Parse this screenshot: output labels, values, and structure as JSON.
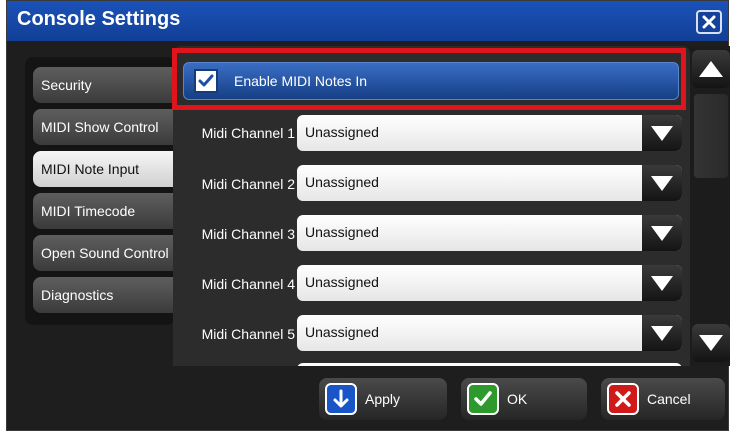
{
  "window": {
    "title": "Console Settings"
  },
  "tabs": [
    {
      "label": "Security",
      "active": false
    },
    {
      "label": "MIDI Show Control",
      "active": false
    },
    {
      "label": "MIDI Note Input",
      "active": true
    },
    {
      "label": "MIDI Timecode",
      "active": false
    },
    {
      "label": "Open Sound Control",
      "active": false
    },
    {
      "label": "Diagnostics",
      "active": false
    }
  ],
  "enable": {
    "label": "Enable MIDI Notes In",
    "checked": true
  },
  "channels": [
    {
      "label": "Midi Channel 1",
      "value": "Unassigned"
    },
    {
      "label": "Midi Channel 2",
      "value": "Unassigned"
    },
    {
      "label": "Midi Channel 3",
      "value": "Unassigned"
    },
    {
      "label": "Midi Channel 4",
      "value": "Unassigned"
    },
    {
      "label": "Midi Channel 5",
      "value": "Unassigned"
    }
  ],
  "buttons": {
    "apply": "Apply",
    "ok": "OK",
    "cancel": "Cancel"
  },
  "colors": {
    "title_bar": "#1b52b8",
    "highlight": "#e0141c",
    "apply_icon": "#1a55c8",
    "ok_icon": "#2e9a2e",
    "cancel_icon": "#d01a1a"
  }
}
